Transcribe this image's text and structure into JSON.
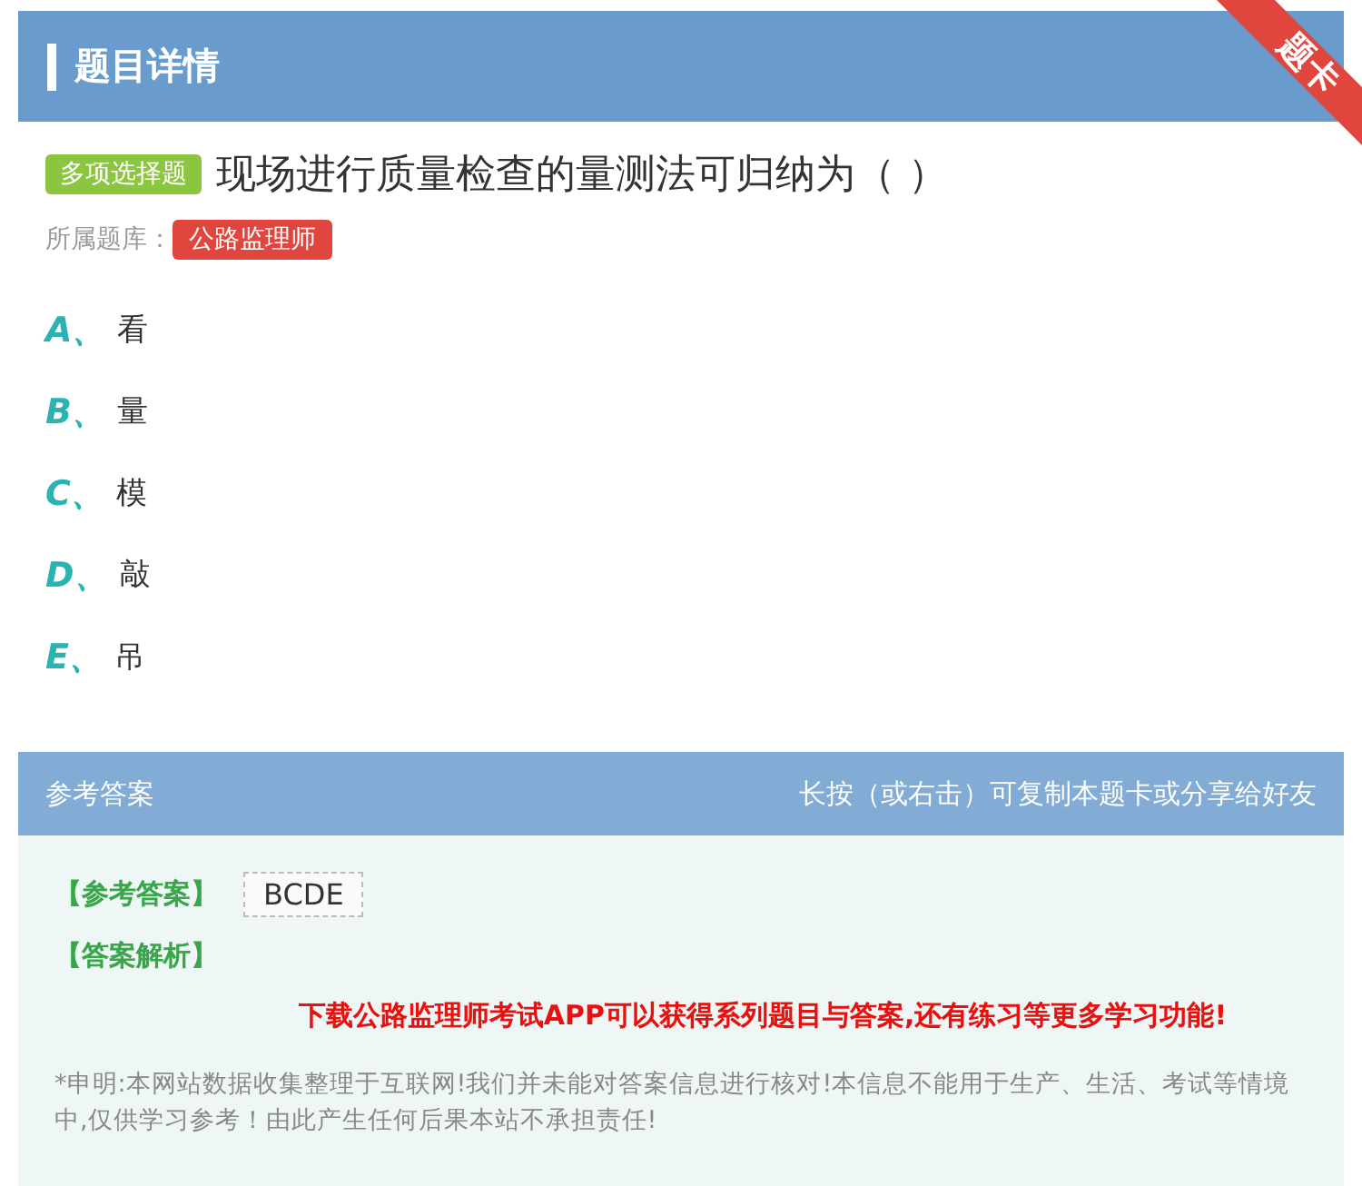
{
  "header": {
    "title": "题目详情",
    "corner_tag": "题卡"
  },
  "question": {
    "type_badge": "多项选择题",
    "text": "现场进行质量检查的量测法可归纳为（   ）",
    "bank_label": "所属题库：",
    "bank_tag": "公路监理师"
  },
  "options": [
    {
      "letter": "A、",
      "text": "看"
    },
    {
      "letter": "B、",
      "text": "量"
    },
    {
      "letter": "C、",
      "text": "模"
    },
    {
      "letter": "D、",
      "text": "敲"
    },
    {
      "letter": "E、",
      "text": "吊"
    }
  ],
  "answer_panel": {
    "title": "参考答案",
    "hint": "长按（或右击）可复制本题卡或分享给好友",
    "answer_label": "【参考答案】",
    "answer": "BCDE",
    "analysis_label": "【答案解析】",
    "promo": "下载公路监理师考试APP可以获得系列题目与答案,还有练习等更多学习功能!",
    "disclaimer": "*申明:本网站数据收集整理于互联网!我们并未能对答案信息进行核对!本信息不能用于生产、生活、考试等情境中,仅供学习参考！由此产生任何后果本站不承担责任!"
  }
}
